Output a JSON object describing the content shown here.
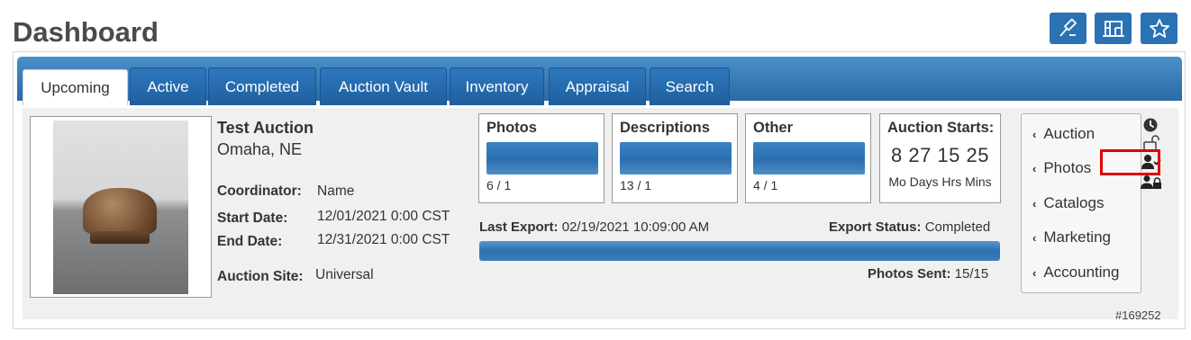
{
  "header": {
    "title": "Dashboard"
  },
  "top_buttons": [
    {
      "icon": "gavel-icon"
    },
    {
      "icon": "building-icon"
    },
    {
      "icon": "star-icon"
    }
  ],
  "tabs": [
    {
      "label": "Upcoming",
      "active": true
    },
    {
      "label": "Active",
      "active": false
    },
    {
      "label": "Completed",
      "active": false
    },
    {
      "label": "Auction Vault",
      "active": false
    },
    {
      "label": "Inventory",
      "active": false
    },
    {
      "label": "Appraisal",
      "active": false
    },
    {
      "label": "Search",
      "active": false
    }
  ],
  "auction": {
    "name": "Test Auction",
    "location": "Omaha, NE",
    "coordinator_label": "Coordinator:",
    "coordinator": "Name",
    "start_label": "Start Date:",
    "start": "12/01/2021 0:00 CST",
    "end_label": "End Date:",
    "end": "12/31/2021 0:00 CST",
    "site_label": "Auction Site:",
    "site": "Universal"
  },
  "stats": {
    "photos": {
      "title": "Photos",
      "value": "6 / 1",
      "progress": 1.0
    },
    "descriptions": {
      "title": "Descriptions",
      "value": "13 / 1",
      "progress": 1.0
    },
    "other": {
      "title": "Other",
      "value": "4 / 1",
      "progress": 1.0
    }
  },
  "countdown": {
    "title": "Auction Starts:",
    "numbers": "8  27 15 25",
    "units": "Mo Days Hrs Mins"
  },
  "export": {
    "last_label": "Last Export:",
    "last_value": "02/19/2021 10:09:00 AM",
    "status_label": "Export Status:",
    "status_value": "Completed",
    "progress": 1.0,
    "sent_label": "Photos Sent:",
    "sent_value": "15/15"
  },
  "side_menu": {
    "items": [
      {
        "label": "Auction"
      },
      {
        "label": "Photos"
      },
      {
        "label": "Catalogs"
      },
      {
        "label": "Marketing"
      },
      {
        "label": "Accounting"
      }
    ]
  },
  "status_icons": [
    "clock-icon",
    "unlock-icon",
    "user-check-icon",
    "users-lock-icon"
  ],
  "reference": "#169252",
  "colors": {
    "accent": "#2b72b4",
    "highlight": "#e00000"
  }
}
